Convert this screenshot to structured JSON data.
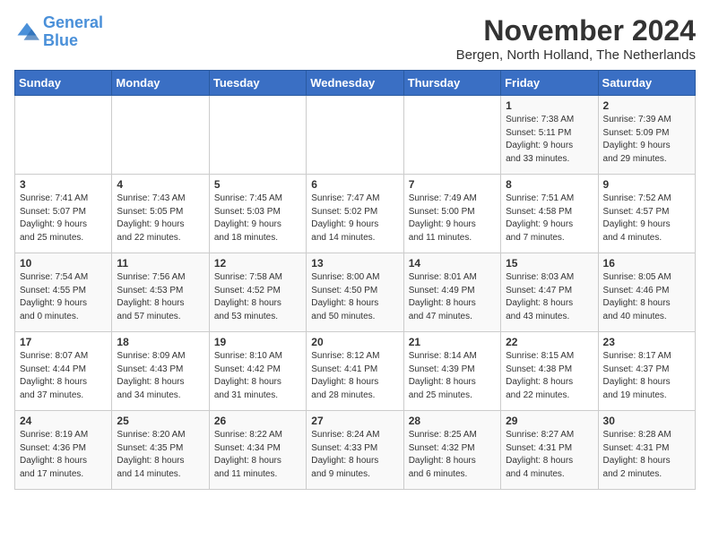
{
  "logo": {
    "line1": "General",
    "line2": "Blue"
  },
  "title": "November 2024",
  "location": "Bergen, North Holland, The Netherlands",
  "days_header": [
    "Sunday",
    "Monday",
    "Tuesday",
    "Wednesday",
    "Thursday",
    "Friday",
    "Saturday"
  ],
  "weeks": [
    [
      {
        "day": "",
        "info": ""
      },
      {
        "day": "",
        "info": ""
      },
      {
        "day": "",
        "info": ""
      },
      {
        "day": "",
        "info": ""
      },
      {
        "day": "",
        "info": ""
      },
      {
        "day": "1",
        "info": "Sunrise: 7:38 AM\nSunset: 5:11 PM\nDaylight: 9 hours\nand 33 minutes."
      },
      {
        "day": "2",
        "info": "Sunrise: 7:39 AM\nSunset: 5:09 PM\nDaylight: 9 hours\nand 29 minutes."
      }
    ],
    [
      {
        "day": "3",
        "info": "Sunrise: 7:41 AM\nSunset: 5:07 PM\nDaylight: 9 hours\nand 25 minutes."
      },
      {
        "day": "4",
        "info": "Sunrise: 7:43 AM\nSunset: 5:05 PM\nDaylight: 9 hours\nand 22 minutes."
      },
      {
        "day": "5",
        "info": "Sunrise: 7:45 AM\nSunset: 5:03 PM\nDaylight: 9 hours\nand 18 minutes."
      },
      {
        "day": "6",
        "info": "Sunrise: 7:47 AM\nSunset: 5:02 PM\nDaylight: 9 hours\nand 14 minutes."
      },
      {
        "day": "7",
        "info": "Sunrise: 7:49 AM\nSunset: 5:00 PM\nDaylight: 9 hours\nand 11 minutes."
      },
      {
        "day": "8",
        "info": "Sunrise: 7:51 AM\nSunset: 4:58 PM\nDaylight: 9 hours\nand 7 minutes."
      },
      {
        "day": "9",
        "info": "Sunrise: 7:52 AM\nSunset: 4:57 PM\nDaylight: 9 hours\nand 4 minutes."
      }
    ],
    [
      {
        "day": "10",
        "info": "Sunrise: 7:54 AM\nSunset: 4:55 PM\nDaylight: 9 hours\nand 0 minutes."
      },
      {
        "day": "11",
        "info": "Sunrise: 7:56 AM\nSunset: 4:53 PM\nDaylight: 8 hours\nand 57 minutes."
      },
      {
        "day": "12",
        "info": "Sunrise: 7:58 AM\nSunset: 4:52 PM\nDaylight: 8 hours\nand 53 minutes."
      },
      {
        "day": "13",
        "info": "Sunrise: 8:00 AM\nSunset: 4:50 PM\nDaylight: 8 hours\nand 50 minutes."
      },
      {
        "day": "14",
        "info": "Sunrise: 8:01 AM\nSunset: 4:49 PM\nDaylight: 8 hours\nand 47 minutes."
      },
      {
        "day": "15",
        "info": "Sunrise: 8:03 AM\nSunset: 4:47 PM\nDaylight: 8 hours\nand 43 minutes."
      },
      {
        "day": "16",
        "info": "Sunrise: 8:05 AM\nSunset: 4:46 PM\nDaylight: 8 hours\nand 40 minutes."
      }
    ],
    [
      {
        "day": "17",
        "info": "Sunrise: 8:07 AM\nSunset: 4:44 PM\nDaylight: 8 hours\nand 37 minutes."
      },
      {
        "day": "18",
        "info": "Sunrise: 8:09 AM\nSunset: 4:43 PM\nDaylight: 8 hours\nand 34 minutes."
      },
      {
        "day": "19",
        "info": "Sunrise: 8:10 AM\nSunset: 4:42 PM\nDaylight: 8 hours\nand 31 minutes."
      },
      {
        "day": "20",
        "info": "Sunrise: 8:12 AM\nSunset: 4:41 PM\nDaylight: 8 hours\nand 28 minutes."
      },
      {
        "day": "21",
        "info": "Sunrise: 8:14 AM\nSunset: 4:39 PM\nDaylight: 8 hours\nand 25 minutes."
      },
      {
        "day": "22",
        "info": "Sunrise: 8:15 AM\nSunset: 4:38 PM\nDaylight: 8 hours\nand 22 minutes."
      },
      {
        "day": "23",
        "info": "Sunrise: 8:17 AM\nSunset: 4:37 PM\nDaylight: 8 hours\nand 19 minutes."
      }
    ],
    [
      {
        "day": "24",
        "info": "Sunrise: 8:19 AM\nSunset: 4:36 PM\nDaylight: 8 hours\nand 17 minutes."
      },
      {
        "day": "25",
        "info": "Sunrise: 8:20 AM\nSunset: 4:35 PM\nDaylight: 8 hours\nand 14 minutes."
      },
      {
        "day": "26",
        "info": "Sunrise: 8:22 AM\nSunset: 4:34 PM\nDaylight: 8 hours\nand 11 minutes."
      },
      {
        "day": "27",
        "info": "Sunrise: 8:24 AM\nSunset: 4:33 PM\nDaylight: 8 hours\nand 9 minutes."
      },
      {
        "day": "28",
        "info": "Sunrise: 8:25 AM\nSunset: 4:32 PM\nDaylight: 8 hours\nand 6 minutes."
      },
      {
        "day": "29",
        "info": "Sunrise: 8:27 AM\nSunset: 4:31 PM\nDaylight: 8 hours\nand 4 minutes."
      },
      {
        "day": "30",
        "info": "Sunrise: 8:28 AM\nSunset: 4:31 PM\nDaylight: 8 hours\nand 2 minutes."
      }
    ]
  ]
}
